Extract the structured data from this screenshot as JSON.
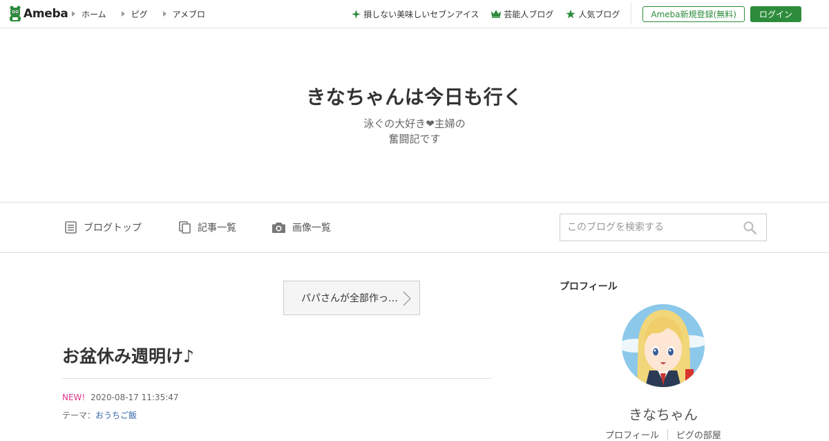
{
  "header": {
    "logo_text": "Ameba",
    "nav": [
      {
        "label": "ホーム"
      },
      {
        "label": "ピグ"
      },
      {
        "label": "アメブロ"
      }
    ],
    "picks": [
      {
        "label": "損しない美味しいセブンアイス",
        "icon": "sparkle-icon"
      },
      {
        "label": "芸能人ブログ",
        "icon": "crown-icon"
      },
      {
        "label": "人気ブログ",
        "icon": "star-icon"
      }
    ],
    "register_label": "Ameba新規登録(無料)",
    "login_label": "ログイン"
  },
  "blog": {
    "title": "きなちゃんは今日も行く",
    "description_line1": "泳ぐの大好き❤主婦の",
    "description_line2": "奮闘記です"
  },
  "blog_nav": {
    "items": [
      {
        "label": "ブログトップ",
        "icon": "document-icon"
      },
      {
        "label": "記事一覧",
        "icon": "copy-icon"
      },
      {
        "label": "画像一覧",
        "icon": "camera-icon"
      }
    ],
    "search_placeholder": "このブログを検索する"
  },
  "main": {
    "prev_entry_label": "パパさんが全部作っ…",
    "entry": {
      "title": "お盆休み週明け♪",
      "new_badge": "NEW!",
      "datetime": "2020-08-17 11:35:47",
      "theme_prefix": "テーマ：",
      "theme": "おうちご飯"
    }
  },
  "sidebar": {
    "title": "プロフィール",
    "name": "きなちゃん",
    "links": [
      {
        "label": "プロフィール"
      },
      {
        "label": "ピグの部屋"
      }
    ]
  },
  "colors": {
    "brand_green": "#2d8c3c",
    "new_badge": "#e0348c",
    "link": "#3366aa"
  }
}
